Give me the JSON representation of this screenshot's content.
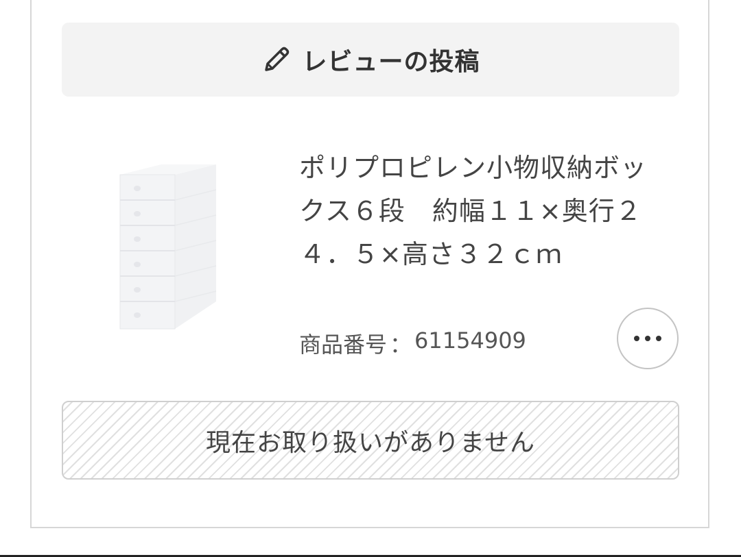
{
  "review": {
    "label": "レビューの投稿",
    "icon": "pencil-icon"
  },
  "product": {
    "image_icon": "storage-box-image",
    "name": "ポリプロピレン小物収納ボックス６段　約幅１１×奥行２４．５×高さ３２ｃｍ",
    "number_label": "商品番号",
    "number_separator": "：",
    "number_value": "61154909",
    "more_icon": "more-dots-icon"
  },
  "status": {
    "label": "現在お取り扱いがありません"
  },
  "colors": {
    "button_bg": "#f3f3f3",
    "text": "#333333",
    "border": "#d6d6d6",
    "stripe": "#e0e0e0"
  }
}
